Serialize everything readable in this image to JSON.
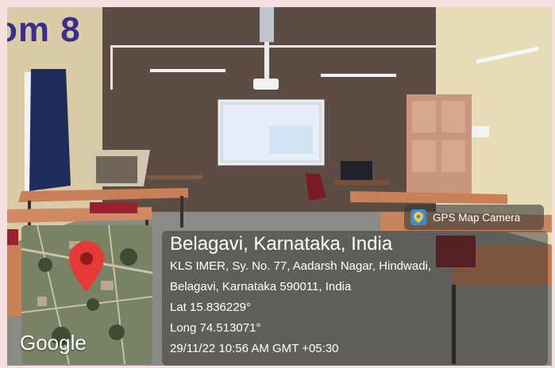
{
  "banner": {
    "text": "om 8"
  },
  "badge": {
    "label": "GPS Map Camera",
    "icon": "map-pin-icon"
  },
  "map": {
    "provider_label": "Google",
    "marker_icon": "location-marker-icon"
  },
  "location": {
    "title": "Belagavi, Karnataka, India",
    "address_line_1": "KLS IMER, Sy. No. 77, Aadarsh Nagar, Hindwadi,",
    "address_line_2": "Belagavi, Karnataka 590011, India",
    "lat": "Lat 15.836229°",
    "long": "Long 74.513071°",
    "timestamp": "29/11/22 10:56 AM GMT +05:30"
  },
  "colors": {
    "banner_text": "#3c2c8e",
    "frame": "#f6e0e0",
    "marker": "#e53935"
  }
}
